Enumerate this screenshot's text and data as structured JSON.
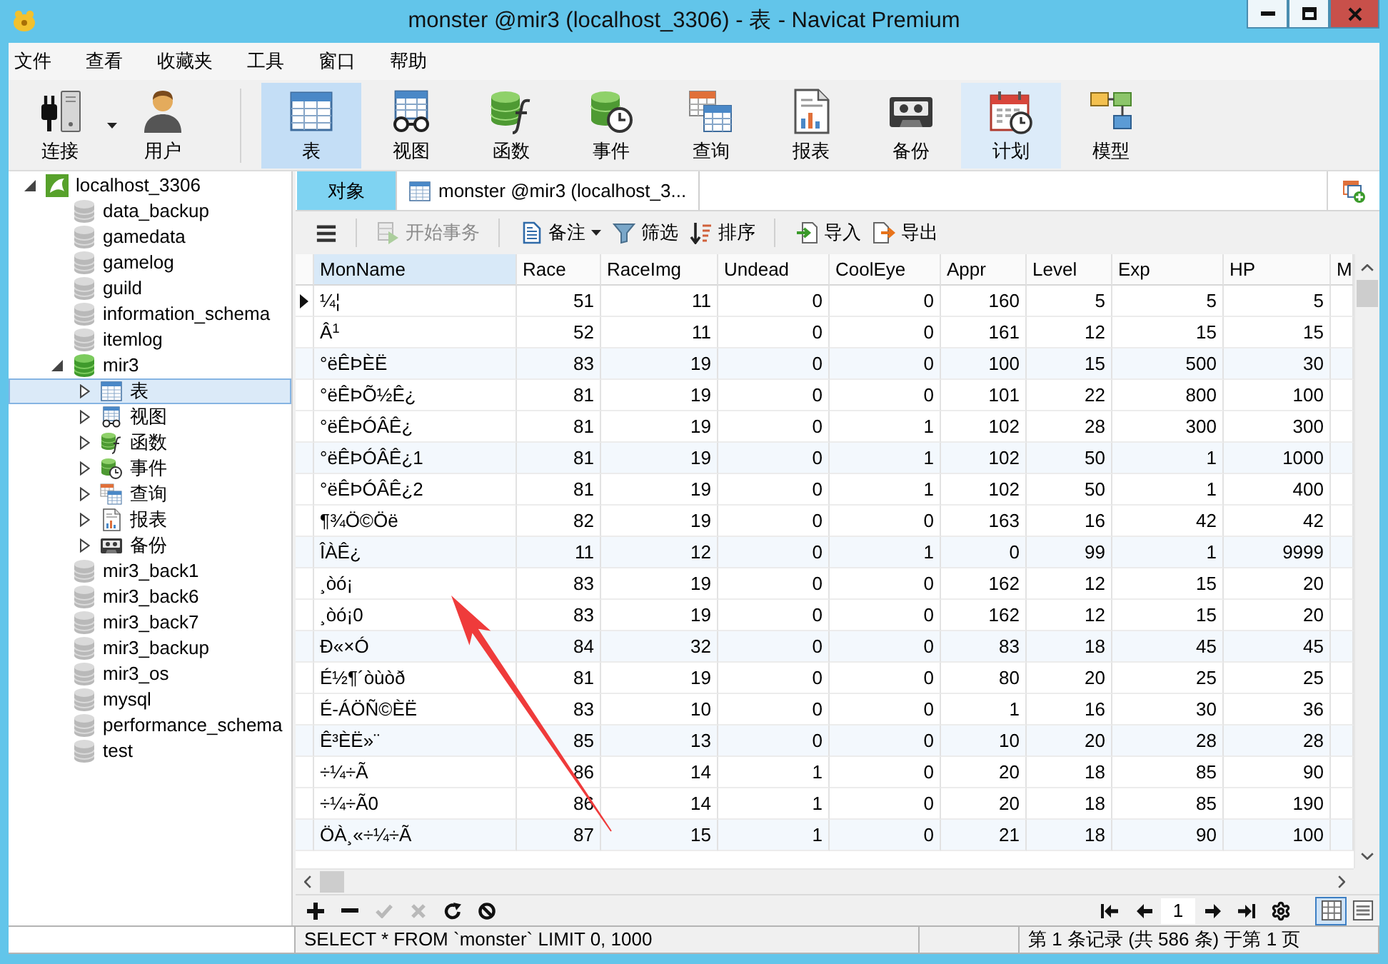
{
  "window": {
    "title": "monster @mir3 (localhost_3306) - 表 - Navicat Premium"
  },
  "menu": [
    "文件",
    "查看",
    "收藏夹",
    "工具",
    "窗口",
    "帮助"
  ],
  "toolbar": {
    "connection": [
      {
        "label": "连接",
        "kind": "connect",
        "dropdown": true
      },
      {
        "label": "用户",
        "kind": "user",
        "dropdown": false
      }
    ],
    "objects": [
      {
        "label": "表",
        "kind": "table",
        "selected": true,
        "hover": false
      },
      {
        "label": "视图",
        "kind": "view",
        "selected": false,
        "hover": false
      },
      {
        "label": "函数",
        "kind": "function",
        "selected": false,
        "hover": false
      },
      {
        "label": "事件",
        "kind": "event",
        "selected": false,
        "hover": false
      },
      {
        "label": "查询",
        "kind": "query",
        "selected": false,
        "hover": false
      },
      {
        "label": "报表",
        "kind": "report",
        "selected": false,
        "hover": false
      },
      {
        "label": "备份",
        "kind": "backup",
        "selected": false,
        "hover": false
      },
      {
        "label": "计划",
        "kind": "schedule",
        "selected": false,
        "hover": true
      },
      {
        "label": "模型",
        "kind": "model",
        "selected": false,
        "hover": false
      }
    ]
  },
  "sidebar": {
    "tree": [
      {
        "label": "localhost_3306",
        "kind": "connection",
        "expanded": true,
        "selected": false,
        "children": [
          {
            "label": "data_backup",
            "kind": "database",
            "open": false,
            "selected": false
          },
          {
            "label": "gamedata",
            "kind": "database",
            "open": false,
            "selected": false
          },
          {
            "label": "gamelog",
            "kind": "database",
            "open": false,
            "selected": false
          },
          {
            "label": "guild",
            "kind": "database",
            "open": false,
            "selected": false
          },
          {
            "label": "information_schema",
            "kind": "database",
            "open": false,
            "selected": false
          },
          {
            "label": "itemlog",
            "kind": "database",
            "open": false,
            "selected": false
          },
          {
            "label": "mir3",
            "kind": "database",
            "open": true,
            "expanded": true,
            "selected": false,
            "children": [
              {
                "label": "表",
                "kind": "table",
                "expanded": false,
                "selected": true
              },
              {
                "label": "视图",
                "kind": "view",
                "expanded": false,
                "selected": false
              },
              {
                "label": "函数",
                "kind": "function",
                "expanded": false,
                "selected": false
              },
              {
                "label": "事件",
                "kind": "event",
                "expanded": false,
                "selected": false
              },
              {
                "label": "查询",
                "kind": "query",
                "expanded": false,
                "selected": false
              },
              {
                "label": "报表",
                "kind": "report",
                "expanded": false,
                "selected": false
              },
              {
                "label": "备份",
                "kind": "backup",
                "expanded": false,
                "selected": false
              }
            ]
          },
          {
            "label": "mir3_back1",
            "kind": "database",
            "open": false,
            "selected": false
          },
          {
            "label": "mir3_back6",
            "kind": "database",
            "open": false,
            "selected": false
          },
          {
            "label": "mir3_back7",
            "kind": "database",
            "open": false,
            "selected": false
          },
          {
            "label": "mir3_backup",
            "kind": "database",
            "open": false,
            "selected": false
          },
          {
            "label": "mir3_os",
            "kind": "database",
            "open": false,
            "selected": false
          },
          {
            "label": "mysql",
            "kind": "database",
            "open": false,
            "selected": false
          },
          {
            "label": "performance_schema",
            "kind": "database",
            "open": false,
            "selected": false
          },
          {
            "label": "test",
            "kind": "database",
            "open": false,
            "selected": false
          }
        ]
      }
    ]
  },
  "tabs": [
    {
      "label": "对象",
      "kind": "objects",
      "selected": false
    },
    {
      "label": "monster @mir3 (localhost_3...",
      "kind": "table",
      "selected": true
    }
  ],
  "grid_toolbar": {
    "groups": [
      [
        {
          "kind": "menu",
          "disabled": false,
          "dropdown": false
        }
      ],
      [
        {
          "label": "开始事务",
          "kind": "transaction",
          "disabled": true,
          "dropdown": false
        }
      ],
      [
        {
          "label": "备注",
          "kind": "memo",
          "disabled": false,
          "dropdown": true
        },
        {
          "label": "筛选",
          "kind": "filter",
          "disabled": false,
          "dropdown": false
        },
        {
          "label": "排序",
          "kind": "sort",
          "disabled": false,
          "dropdown": false
        }
      ],
      [
        {
          "label": "导入",
          "kind": "import",
          "disabled": false,
          "dropdown": false
        },
        {
          "label": "导出",
          "kind": "export",
          "disabled": false,
          "dropdown": false
        }
      ]
    ]
  },
  "table": {
    "columns": [
      {
        "label": "MonName",
        "selected": true
      },
      {
        "label": "Race",
        "selected": false
      },
      {
        "label": "RaceImg",
        "selected": false
      },
      {
        "label": "Undead",
        "selected": false
      },
      {
        "label": "CoolEye",
        "selected": false
      },
      {
        "label": "Appr",
        "selected": false
      },
      {
        "label": "Level",
        "selected": false
      },
      {
        "label": "Exp",
        "selected": false
      },
      {
        "label": "HP",
        "selected": false
      },
      {
        "label": "M",
        "selected": false
      }
    ],
    "rows": [
      {
        "current": true,
        "cells": [
          "¼¦",
          "51",
          "11",
          "0",
          "0",
          "160",
          "5",
          "5",
          "5"
        ]
      },
      {
        "current": false,
        "cells": [
          "Â$^{1}$",
          "52",
          "11",
          "0",
          "0",
          "161",
          "12",
          "15",
          "15"
        ]
      },
      {
        "current": false,
        "cells": [
          "°ëÊÞÈË",
          "83",
          "19",
          "0",
          "0",
          "100",
          "15",
          "500",
          "30"
        ]
      },
      {
        "current": false,
        "cells": [
          "°ëÊÞÕ½Ê¿",
          "81",
          "19",
          "0",
          "0",
          "101",
          "22",
          "800",
          "100"
        ]
      },
      {
        "current": false,
        "cells": [
          "°ëÊÞÓÂÊ¿",
          "81",
          "19",
          "0",
          "1",
          "102",
          "28",
          "300",
          "300"
        ]
      },
      {
        "current": false,
        "cells": [
          "°ëÊÞÓÂÊ¿1",
          "81",
          "19",
          "0",
          "1",
          "102",
          "50",
          "1",
          "1000"
        ]
      },
      {
        "current": false,
        "cells": [
          "°ëÊÞÓÂÊ¿2",
          "81",
          "19",
          "0",
          "1",
          "102",
          "50",
          "1",
          "400"
        ]
      },
      {
        "current": false,
        "cells": [
          "¶¾Ö©Öë",
          "82",
          "19",
          "0",
          "0",
          "163",
          "16",
          "42",
          "42"
        ]
      },
      {
        "current": false,
        "cells": [
          "ÎÀÊ¿",
          "11",
          "12",
          "0",
          "1",
          "0",
          "99",
          "1",
          "9999"
        ]
      },
      {
        "current": false,
        "cells": [
          "¸òó¡",
          "83",
          "19",
          "0",
          "0",
          "162",
          "12",
          "15",
          "20"
        ]
      },
      {
        "current": false,
        "cells": [
          "¸òó¡0",
          "83",
          "19",
          "0",
          "0",
          "162",
          "12",
          "15",
          "20"
        ]
      },
      {
        "current": false,
        "cells": [
          "Ð«×Ó",
          "84",
          "32",
          "0",
          "0",
          "83",
          "18",
          "45",
          "45"
        ]
      },
      {
        "current": false,
        "cells": [
          "É½¶´òùòð",
          "81",
          "19",
          "0",
          "0",
          "80",
          "20",
          "25",
          "25"
        ]
      },
      {
        "current": false,
        "cells": [
          "É-ÁÖÑ©ÈË",
          "83",
          "10",
          "0",
          "0",
          "1",
          "16",
          "30",
          "36"
        ]
      },
      {
        "current": false,
        "cells": [
          "Ê³ÈË»¨",
          "85",
          "13",
          "0",
          "0",
          "10",
          "20",
          "28",
          "28"
        ]
      },
      {
        "current": false,
        "cells": [
          "÷¼÷Ã",
          "86",
          "14",
          "1",
          "0",
          "20",
          "18",
          "85",
          "90"
        ]
      },
      {
        "current": false,
        "cells": [
          "÷¼÷Ã0",
          "86",
          "14",
          "1",
          "0",
          "20",
          "18",
          "85",
          "190"
        ]
      },
      {
        "current": false,
        "cells": [
          "ÖÀ¸«÷¼÷Ã",
          "87",
          "15",
          "1",
          "0",
          "21",
          "18",
          "90",
          "100"
        ]
      }
    ]
  },
  "record_actions": [
    {
      "kind": "add",
      "disabled": false
    },
    {
      "kind": "delete",
      "disabled": false
    },
    {
      "kind": "apply",
      "disabled": true
    },
    {
      "kind": "discard",
      "disabled": true
    },
    {
      "kind": "refresh",
      "disabled": false
    },
    {
      "kind": "stop",
      "disabled": false
    }
  ],
  "pager": {
    "page": "1"
  },
  "view_modes": [
    {
      "kind": "grid",
      "selected": true
    },
    {
      "kind": "form",
      "selected": false
    }
  ],
  "status_bar": {
    "query": "SELECT * FROM `monster` LIMIT 0, 1000",
    "record_info": "第 1 条记录 (共 586 条) 于第 1 页"
  }
}
